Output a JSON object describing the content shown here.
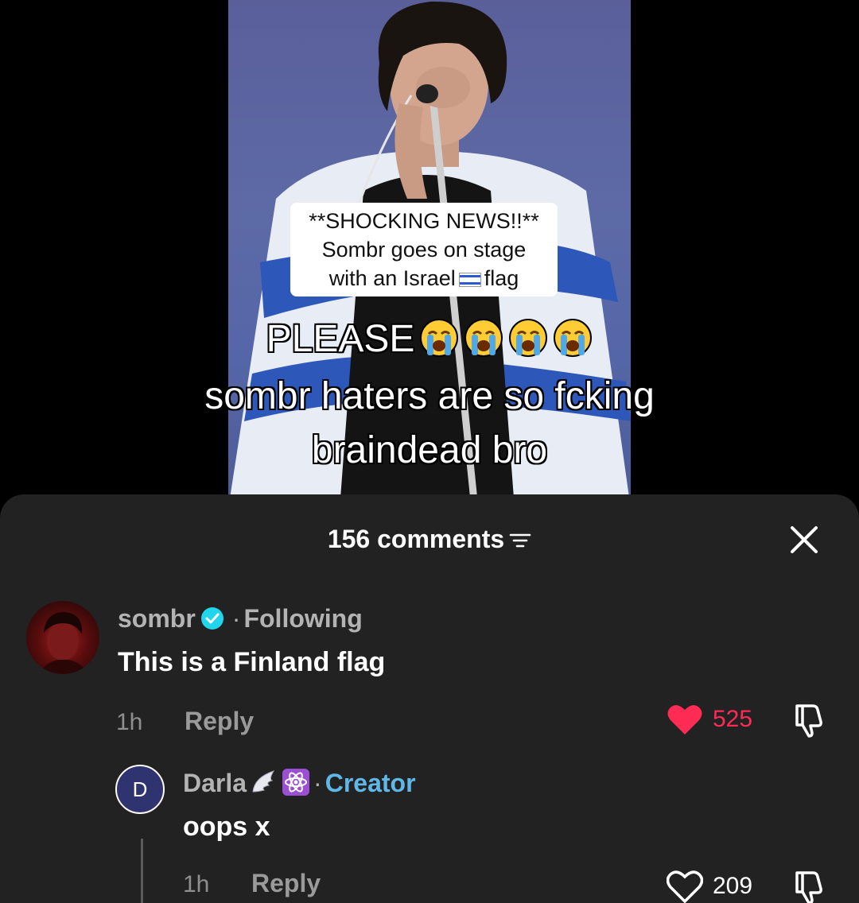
{
  "video": {
    "caption_line1": "**SHOCKING NEWS!!**",
    "caption_line2": "Sombr goes on stage",
    "caption_line3_before": "with an Israel",
    "caption_line3_after": "flag",
    "overlay_line1": "PLEASE",
    "overlay_line2": "sombr haters are so fcking",
    "overlay_line3": "braindead bro",
    "emoji_count": 4
  },
  "sheet": {
    "comments_count": "156 comments",
    "close_icon": "close-icon",
    "filter_icon": "filter-icon"
  },
  "comments": [
    {
      "author": "sombr",
      "verified": true,
      "tag": "Following",
      "text": "This is a Finland flag",
      "time": "1h",
      "reply_label": "Reply",
      "likes": "525",
      "liked": true,
      "like_color": "#fe2c55"
    },
    {
      "author": "Darla",
      "avatar_letter": "D",
      "tag": "Creator",
      "text": "oops x",
      "time": "1h",
      "reply_label": "Reply",
      "likes": "209",
      "liked": false
    }
  ],
  "colors": {
    "sheet_bg": "#222222",
    "creator_tag": "#5fb8e8",
    "verified": "#20d5ec"
  }
}
